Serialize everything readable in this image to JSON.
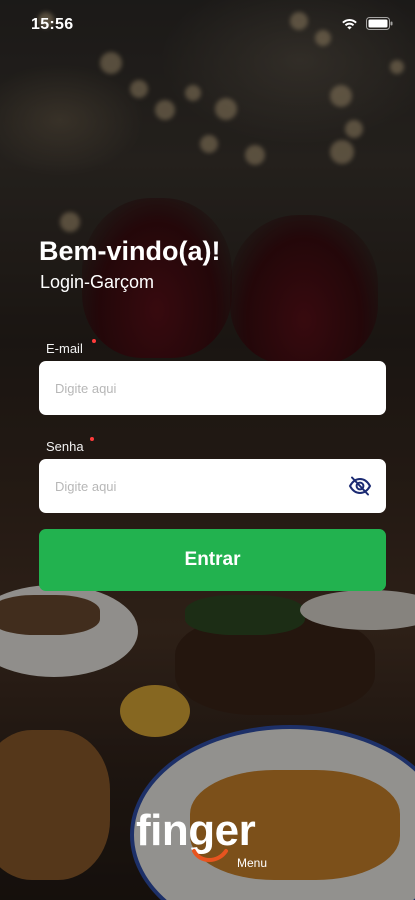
{
  "status_bar": {
    "time": "15:56"
  },
  "header": {
    "title": "Bem-vindo(a)!",
    "subtitle": "Login-Garçom"
  },
  "form": {
    "email": {
      "label": "E-mail",
      "placeholder": "Digite aqui",
      "value": ""
    },
    "password": {
      "label": "Senha",
      "placeholder": "Digite aqui",
      "value": ""
    },
    "submit_label": "Entrar"
  },
  "brand": {
    "logo_text": "finger",
    "logo_sub": "Menu"
  },
  "colors": {
    "accent": "#22b24f",
    "required": "#ff3b3b",
    "logo_accent": "#e8541f"
  }
}
